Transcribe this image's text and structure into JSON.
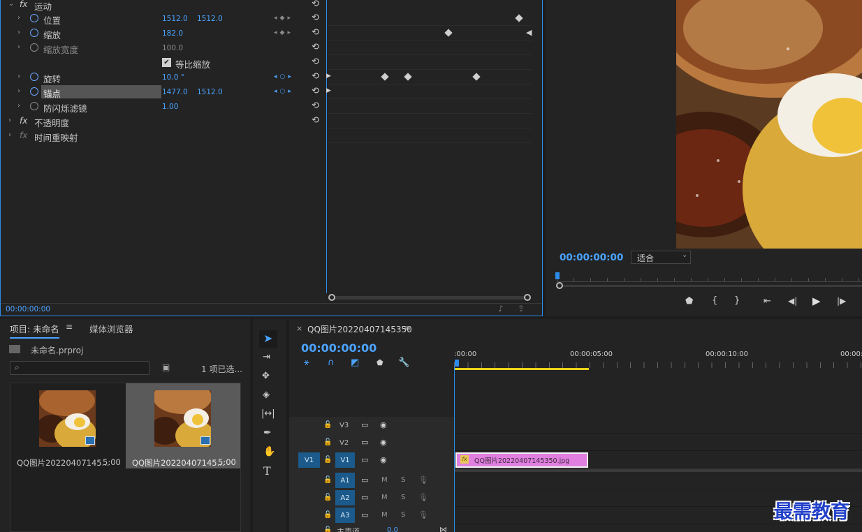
{
  "effects": {
    "motion_label": "运动",
    "rows": [
      {
        "label": "位置",
        "v1": "1512.0",
        "v2": "1512.0"
      },
      {
        "label": "缩放",
        "v1": "182.0",
        "v2": ""
      },
      {
        "label": "缩放宽度",
        "v1": "100.0",
        "v2": ""
      },
      {
        "label": "等比缩放",
        "v1": "",
        "v2": ""
      },
      {
        "label": "旋转",
        "v1": "10.0 °",
        "v2": ""
      },
      {
        "label": "锚点",
        "v1": "1477.0",
        "v2": "1512.0"
      },
      {
        "label": "防闪烁滤镜",
        "v1": "1.00",
        "v2": ""
      }
    ],
    "opacity_label": "不透明度",
    "timeremap_label": "时间重映射",
    "timecode": "00:00:00:00",
    "fx_glyph": "fx"
  },
  "program": {
    "timecode": "00:00:00:00",
    "fit_label": "适合"
  },
  "project": {
    "tab_project": "项目: 未命名",
    "tab_media": "媒体浏览器",
    "filename": "未命名.prproj",
    "selected_count": "1 项已选...",
    "items": [
      {
        "name": "QQ图片20220407145...",
        "duration": "5:00"
      },
      {
        "name": "QQ图片20220407145...",
        "duration": "5:00"
      }
    ]
  },
  "timeline": {
    "sequence_name": "QQ图片20220407145350",
    "timecode": "00:00:00:00",
    "ruler": [
      ":00:00",
      "00:00:05:00",
      "00:00:10:00",
      "00:00:"
    ],
    "tracks_video": [
      "V3",
      "V2",
      "V1"
    ],
    "tracks_audio": [
      "A1",
      "A2",
      "A3"
    ],
    "source_patch": "V1",
    "clip_name": "QQ图片20220407145350.jpg",
    "master_label": "主声道",
    "master_value": "0.0",
    "mute": "M",
    "solo": "S"
  },
  "watermark": "最需教育",
  "colors": {
    "accent": "#2d8ceb",
    "clip": "#e17fe0",
    "work_area": "#e8d41a"
  }
}
